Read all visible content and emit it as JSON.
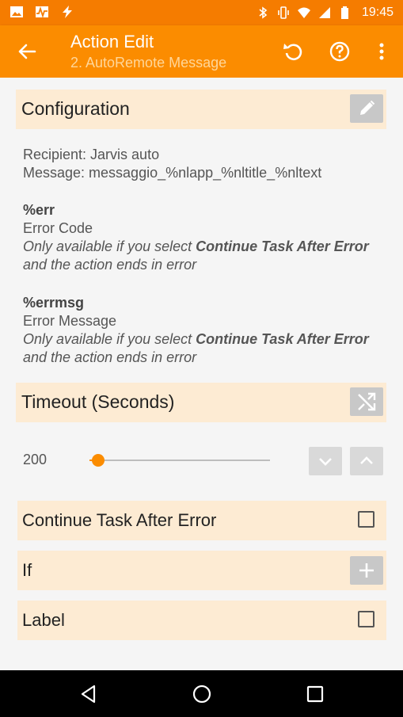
{
  "status_bar": {
    "time": "19:45",
    "left_icons": [
      "image-icon",
      "activity-icon",
      "flash-icon"
    ],
    "right_icons": [
      "bluetooth-icon",
      "vibrate-icon",
      "wifi-icon",
      "signal-icon",
      "battery-icon"
    ]
  },
  "app_bar": {
    "title": "Action Edit",
    "subtitle": "2. AutoRemote Message",
    "actions": [
      "back-icon",
      "undo-icon",
      "help-icon",
      "overflow-menu-icon"
    ]
  },
  "configuration": {
    "header": "Configuration",
    "recipient": "Recipient: Jarvis auto",
    "message": "Message: messaggio_%nlapp_%nltitle_%nltext"
  },
  "variables": [
    {
      "name": "%err",
      "description": "Error Code",
      "note_prefix": "Only available if you select ",
      "note_bold": "Continue Task After Error",
      "note_suffix": "and the action ends in error"
    },
    {
      "name": "%errmsg",
      "description": "Error Message",
      "note_prefix": "Only available if you select ",
      "note_bold": "Continue Task After Error",
      "note_suffix": "and the action ends in error"
    }
  ],
  "timeout": {
    "header": "Timeout (Seconds)",
    "value": "200",
    "slider_fraction": 0.05
  },
  "continue_task": {
    "label": "Continue Task After Error",
    "checked": false
  },
  "if_section": {
    "label": "If"
  },
  "label_section": {
    "label": "Label",
    "checked": false
  },
  "colors": {
    "status_bar": "#f57c00",
    "app_bar": "#fb8c00",
    "section_bg": "#fdebd3",
    "accent": "#fb8c00"
  }
}
